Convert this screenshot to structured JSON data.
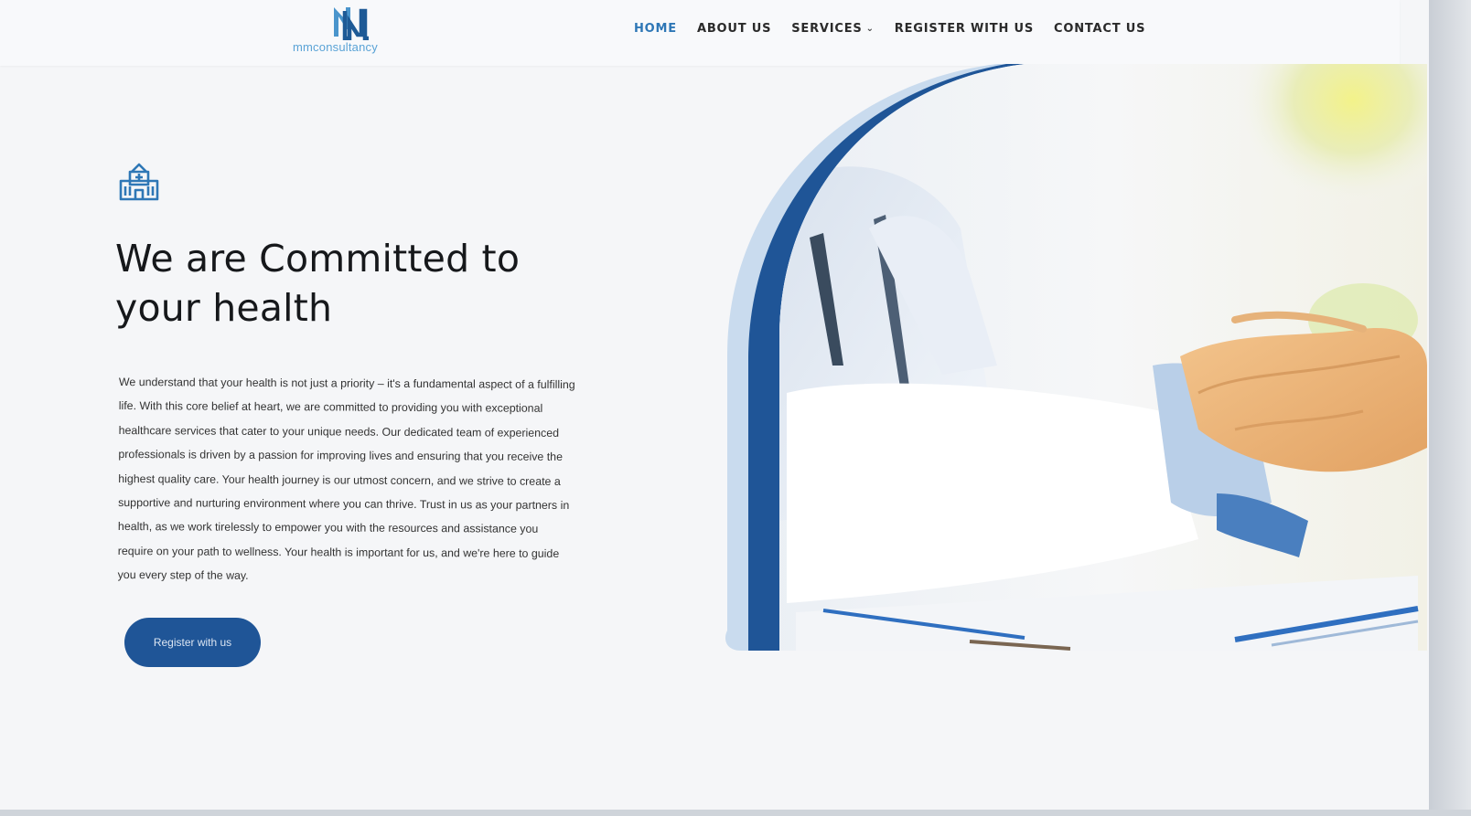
{
  "brand": {
    "logo_text": "mmconsultancy",
    "accent_color": "#2e77b6",
    "button_color": "#1f5597"
  },
  "nav": {
    "items": [
      {
        "label": "HOME",
        "active": true
      },
      {
        "label": "ABOUT US",
        "active": false
      },
      {
        "label": "SERVICES",
        "active": false,
        "has_dropdown": true
      },
      {
        "label": "REGISTER WITH US",
        "active": false
      },
      {
        "label": "CONTACT US",
        "active": false
      }
    ],
    "dropdown_icon": "chevron-down-icon"
  },
  "hero": {
    "icon": "hospital-icon",
    "title_line1": "We are Committed to",
    "title_line2": "your health",
    "body": "We understand that your health is not just a priority – it's a fundamental aspect of a fulfilling life. With this core belief at heart, we are committed to providing you with exceptional healthcare services that cater to your unique needs. Our dedicated team of experienced professionals is driven by a passion for improving lives and ensuring that you receive the highest quality care. Your health journey is our utmost concern, and we strive to create a supportive and nurturing environment where you can thrive. Trust in us as your partners in health, as we work tirelessly to empower you with the resources and assistance you require on your path to wellness. Your health is important for us, and we're here to guide you every step of the way.",
    "cta_label": "Register with us",
    "image_subject": "doctor-handshake-photo"
  }
}
